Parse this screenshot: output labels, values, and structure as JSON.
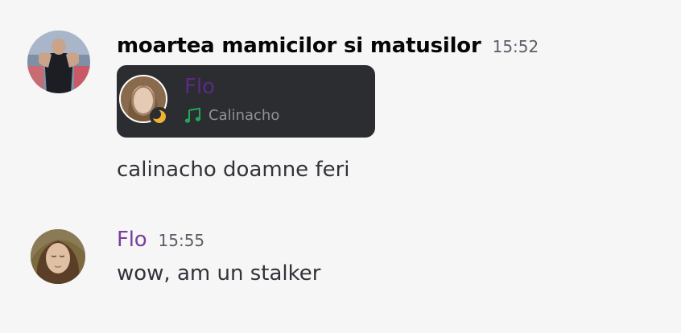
{
  "messages": [
    {
      "author": "moartea mamicilor si matusilor",
      "time": "15:52",
      "presence_embed": {
        "name": "Flo",
        "activity": "Calinacho",
        "status": "idle-moon-icon",
        "activity_icon": "music-note-icon"
      },
      "text": "calinacho doamne feri"
    },
    {
      "author": "Flo",
      "time": "15:55",
      "text": "wow, am un stalker"
    }
  ],
  "colors": {
    "background": "#f6f6f7",
    "embed_background": "#2b2d31",
    "flo_name": "#7a3e9d",
    "activity_green": "#23a55a",
    "idle_yellow": "#f0b232"
  }
}
